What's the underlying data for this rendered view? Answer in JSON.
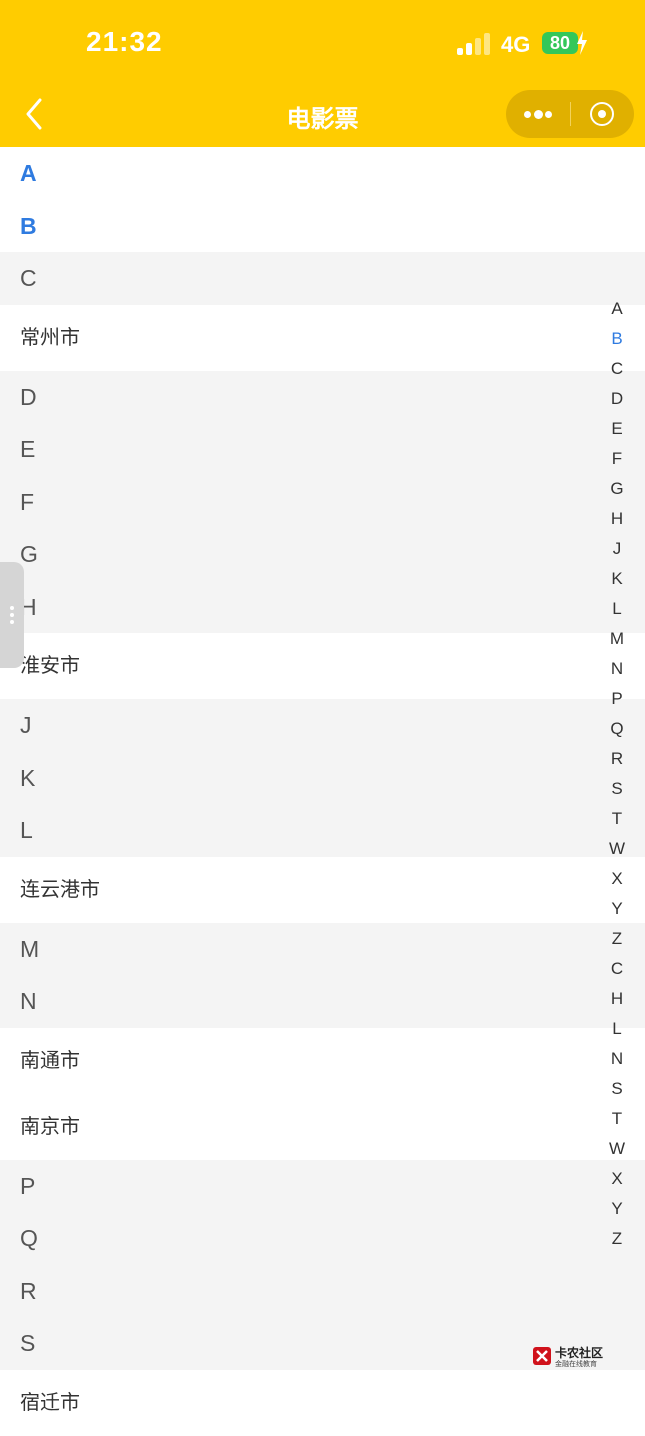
{
  "status_bar": {
    "time": "21:32",
    "network": "4G",
    "battery": "80"
  },
  "nav": {
    "title": "电影票"
  },
  "colors": {
    "nav_bg": "#ffcc00",
    "accent": "#2f7be0",
    "battery": "#34c759",
    "section_bg": "#f4f4f4"
  },
  "sections": [
    {
      "letter": "A",
      "active": true,
      "cities": []
    },
    {
      "letter": "B",
      "active": true,
      "cities": []
    },
    {
      "letter": "C",
      "active": false,
      "cities": [
        "常州市"
      ]
    },
    {
      "letter": "D",
      "active": false,
      "cities": []
    },
    {
      "letter": "E",
      "active": false,
      "cities": []
    },
    {
      "letter": "F",
      "active": false,
      "cities": []
    },
    {
      "letter": "G",
      "active": false,
      "cities": []
    },
    {
      "letter": "H",
      "active": false,
      "cities": [
        "淮安市"
      ]
    },
    {
      "letter": "J",
      "active": false,
      "cities": []
    },
    {
      "letter": "K",
      "active": false,
      "cities": []
    },
    {
      "letter": "L",
      "active": false,
      "cities": [
        "连云港市"
      ]
    },
    {
      "letter": "M",
      "active": false,
      "cities": []
    },
    {
      "letter": "N",
      "active": false,
      "cities": [
        "南通市",
        "南京市"
      ]
    },
    {
      "letter": "P",
      "active": false,
      "cities": []
    },
    {
      "letter": "Q",
      "active": false,
      "cities": []
    },
    {
      "letter": "R",
      "active": false,
      "cities": []
    },
    {
      "letter": "S",
      "active": false,
      "cities": [
        "宿迁市"
      ]
    }
  ],
  "index_letters": [
    "A",
    "B",
    "C",
    "D",
    "E",
    "F",
    "G",
    "H",
    "J",
    "K",
    "L",
    "M",
    "N",
    "P",
    "Q",
    "R",
    "S",
    "T",
    "W",
    "X",
    "Y",
    "Z",
    "C",
    "H",
    "L",
    "N",
    "S",
    "T",
    "W",
    "X",
    "Y",
    "Z"
  ],
  "index_active": 1,
  "watermark": {
    "name": "卡农社区",
    "tagline": "金融在线教育"
  }
}
